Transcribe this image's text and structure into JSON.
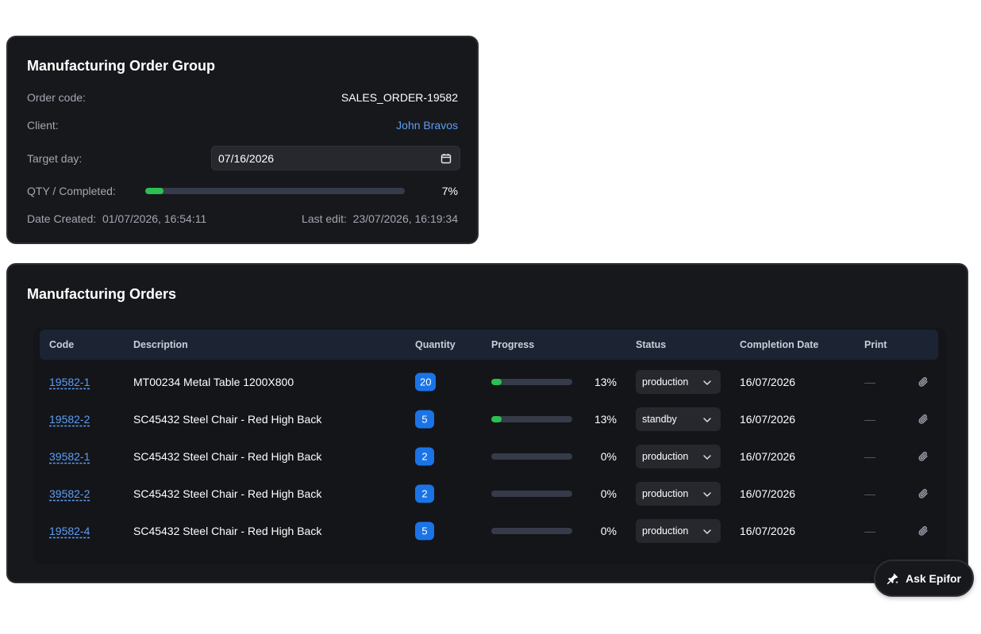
{
  "group": {
    "title": "Manufacturing Order Group",
    "order_code_label": "Order code:",
    "order_code": "SALES_ORDER-19582",
    "client_label": "Client:",
    "client": "John Bravos",
    "target_label": "Target day:",
    "target_date": "07/16/2026",
    "qty_label": "QTY / Completed:",
    "progress_percent": 7,
    "progress_text": "7%",
    "date_created_label": "Date Created:",
    "date_created": "01/07/2026, 16:54:11",
    "last_edit_label": "Last edit:",
    "last_edit": "23/07/2026, 16:19:34"
  },
  "orders": {
    "title": "Manufacturing Orders",
    "columns": {
      "code": "Code",
      "description": "Description",
      "quantity": "Quantity",
      "progress": "Progress",
      "status": "Status",
      "completion_date": "Completion Date",
      "print": "Print"
    },
    "rows": [
      {
        "code": "19582-1",
        "description": "MT00234 Metal Table 1200X800",
        "quantity": "20",
        "progress": 13,
        "progress_text": "13%",
        "status": "production",
        "completion_date": "16/07/2026",
        "print": "—"
      },
      {
        "code": "19582-2",
        "description": "SC45432 Steel Chair - Red High Back",
        "quantity": "5",
        "progress": 13,
        "progress_text": "13%",
        "status": "standby",
        "completion_date": "16/07/2026",
        "print": "—"
      },
      {
        "code": "39582-1",
        "description": "SC45432 Steel Chair - Red High Back",
        "quantity": "2",
        "progress": 0,
        "progress_text": "0%",
        "status": "production",
        "completion_date": "16/07/2026",
        "print": "—"
      },
      {
        "code": "39582-2",
        "description": "SC45432 Steel Chair - Red High Back",
        "quantity": "2",
        "progress": 0,
        "progress_text": "0%",
        "status": "production",
        "completion_date": "16/07/2026",
        "print": "—"
      },
      {
        "code": "19582-4",
        "description": "SC45432 Steel Chair - Red High Back",
        "quantity": "5",
        "progress": 0,
        "progress_text": "0%",
        "status": "production",
        "completion_date": "16/07/2026",
        "print": "—"
      }
    ]
  },
  "ask": {
    "label": "Ask Epifor",
    "icon": "sparkle-pin-icon"
  },
  "icons": {
    "target_date": "calendar-icon",
    "status_select": "chevron-down-icon",
    "row_attachment": "paperclip-icon"
  },
  "colors": {
    "card_bg": "#17181c",
    "accent_blue": "#1a74e8",
    "link_blue": "#5e9df6",
    "progress_green": "#2bc052",
    "track": "#353b48",
    "table_header_bg": "#1c2433"
  }
}
